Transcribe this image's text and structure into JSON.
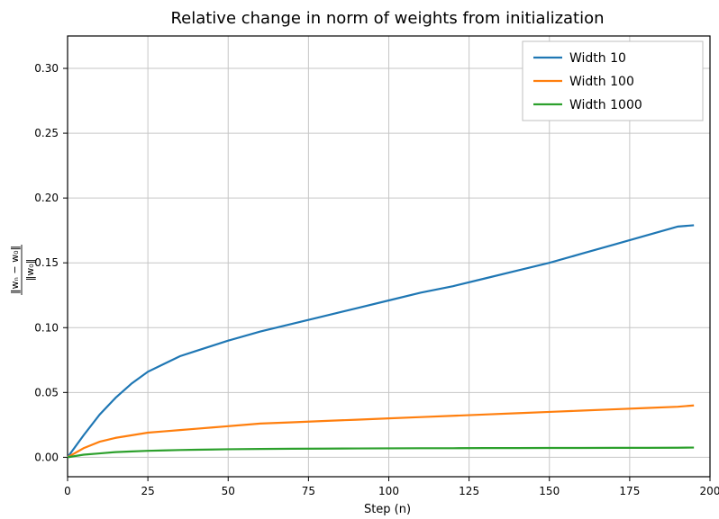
{
  "chart_data": {
    "type": "line",
    "title": "Relative change in norm of weights from initialization",
    "xlabel": "Step (n)",
    "ylabel_tex": "‖wₙ − w₀‖ / ‖w₀‖",
    "xlim": [
      0,
      200
    ],
    "ylim": [
      -0.015,
      0.325
    ],
    "xticks": [
      0,
      25,
      50,
      75,
      100,
      125,
      150,
      175,
      200
    ],
    "yticks": [
      0.0,
      0.05,
      0.1,
      0.15,
      0.2,
      0.25,
      0.3
    ],
    "ytick_labels": [
      "0.00",
      "0.05",
      "0.10",
      "0.15",
      "0.20",
      "0.25",
      "0.30"
    ],
    "colors": {
      "w10": "#1f77b4",
      "w100": "#ff7f0e",
      "w1000": "#2ca02c"
    },
    "x": [
      0,
      5,
      10,
      15,
      20,
      25,
      30,
      35,
      40,
      45,
      50,
      60,
      70,
      80,
      90,
      100,
      110,
      120,
      130,
      140,
      150,
      160,
      170,
      180,
      190,
      195
    ],
    "series": [
      {
        "name": "Width 10",
        "key": "w10",
        "values": [
          0.0,
          0.017,
          0.033,
          0.046,
          0.057,
          0.066,
          0.072,
          0.078,
          0.082,
          0.086,
          0.09,
          0.097,
          0.103,
          0.109,
          0.115,
          0.121,
          0.127,
          0.132,
          0.138,
          0.144,
          0.15,
          0.157,
          0.164,
          0.171,
          0.178,
          0.179
        ]
      },
      {
        "name": "Width 100",
        "key": "w100",
        "values": [
          0.0,
          0.007,
          0.012,
          0.015,
          0.017,
          0.019,
          0.02,
          0.021,
          0.022,
          0.023,
          0.024,
          0.026,
          0.027,
          0.028,
          0.029,
          0.03,
          0.031,
          0.032,
          0.033,
          0.034,
          0.035,
          0.036,
          0.037,
          0.038,
          0.039,
          0.04
        ]
      },
      {
        "name": "Width 1000",
        "key": "w1000",
        "values": [
          0.0,
          0.002,
          0.003,
          0.004,
          0.0045,
          0.005,
          0.0053,
          0.0056,
          0.0058,
          0.006,
          0.0062,
          0.0064,
          0.0066,
          0.0067,
          0.0068,
          0.0069,
          0.007,
          0.007,
          0.0071,
          0.0071,
          0.0072,
          0.0072,
          0.0073,
          0.0073,
          0.0074,
          0.0075
        ]
      }
    ],
    "legend": {
      "position": "upper-right",
      "entries": [
        "Width 10",
        "Width 100",
        "Width 1000"
      ]
    }
  }
}
